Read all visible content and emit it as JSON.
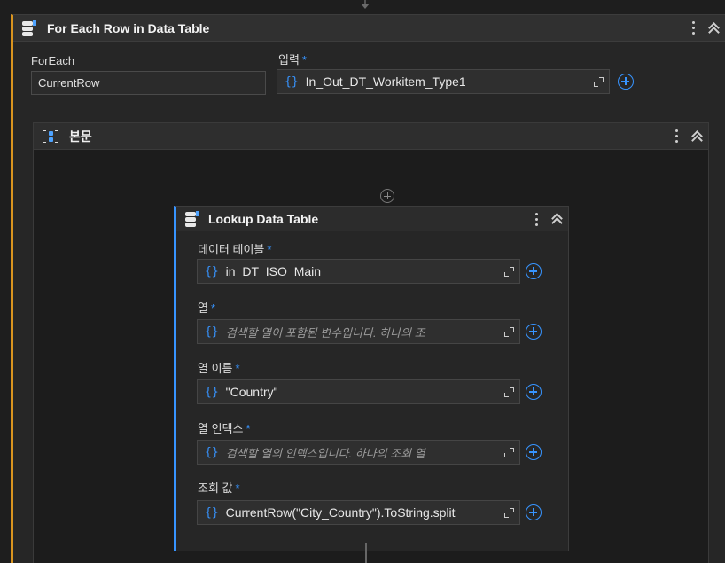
{
  "foreach": {
    "title": "For Each Row in Data Table",
    "foreach_label": "ForEach",
    "foreach_value": "CurrentRow",
    "input_label": "입력",
    "input_required": "*",
    "input_value": "In_Out_DT_Workitem_Type1"
  },
  "body": {
    "title": "본문"
  },
  "lookup": {
    "title": "Lookup Data Table",
    "fields": [
      {
        "label": "데이터 테이블",
        "required": "*",
        "value": "in_DT_ISO_Main",
        "is_placeholder": false
      },
      {
        "label": "열",
        "required": "*",
        "value": "검색할 열이 포함된 변수입니다. 하나의 조",
        "is_placeholder": true
      },
      {
        "label": "열 이름",
        "required": "*",
        "value": "\"Country\"",
        "is_placeholder": false
      },
      {
        "label": "열 인덱스",
        "required": "*",
        "value": "검색할 열의 인덱스입니다. 하나의 조회 열",
        "is_placeholder": true
      },
      {
        "label": "조회 값",
        "required": "*",
        "value": "CurrentRow(\"City_Country\").ToString.split",
        "is_placeholder": false
      }
    ]
  },
  "icons": {
    "expression_brace": "{}",
    "accent_color": "#3794ff",
    "foreach_border_color": "#d9941f"
  }
}
